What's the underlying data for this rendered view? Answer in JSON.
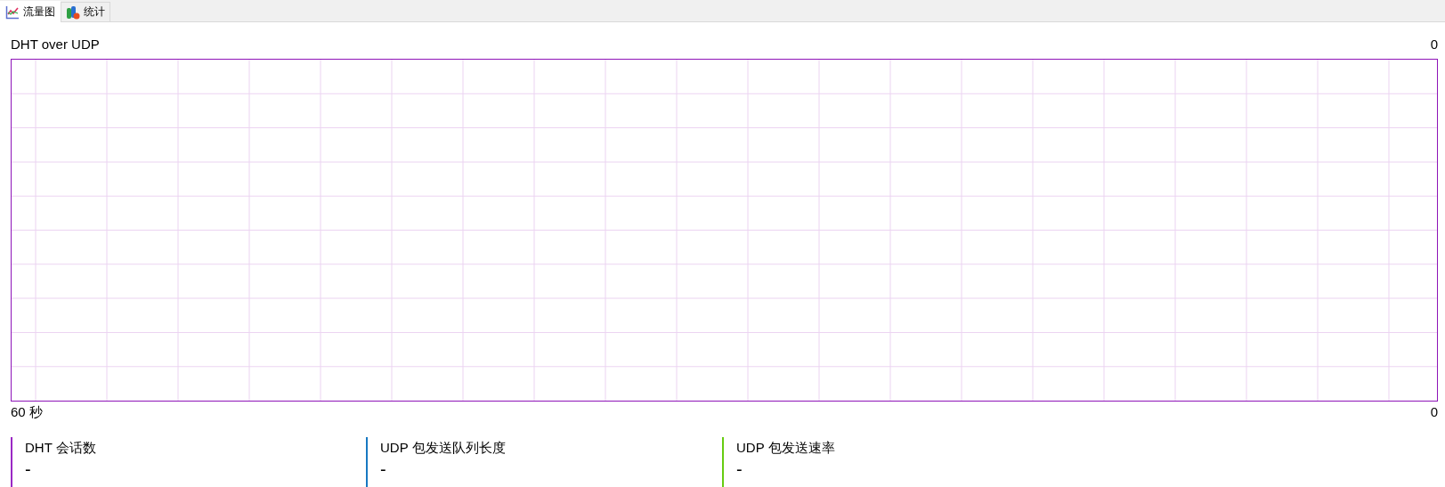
{
  "tabs": [
    {
      "label": "流量图",
      "kind": "graph",
      "selected": true
    },
    {
      "label": "统计",
      "kind": "stats",
      "selected": false
    }
  ],
  "graph": {
    "title": "DHT over UDP",
    "max_label": "0",
    "time_label": "60 秒",
    "min_label": "0"
  },
  "legend": [
    {
      "name": "DHT 会话数",
      "value": "-",
      "color": "#9a28c4"
    },
    {
      "name": "UDP 包发送队列长度",
      "value": "-",
      "color": "#1778c2"
    },
    {
      "name": "UDP 包发送速率",
      "value": "-",
      "color": "#66cc11"
    }
  ]
}
